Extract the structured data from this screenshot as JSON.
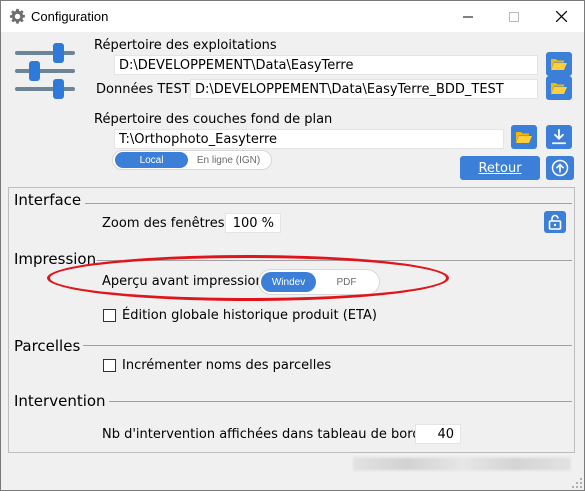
{
  "window": {
    "title": "Configuration",
    "icon": "gear-icon",
    "controls": {
      "minimize": "—",
      "maximize": "☐",
      "close": "✕"
    }
  },
  "top": {
    "exploitations_label": "Répertoire des exploitations",
    "exploitations_path": "D:\\DEVELOPPEMENT\\Data\\EasyTerre",
    "test_label": "Données TEST",
    "test_path": "D:\\DEVELOPPEMENT\\Data\\EasyTerre_BDD_TEST",
    "fond_label": "Répertoire des couches fond de plan",
    "fond_path": "T:\\Orthophoto_Easyterre",
    "source_toggle": {
      "options": [
        "Local",
        "En ligne (IGN)"
      ],
      "selected": "Local"
    },
    "retour_label": "Retour"
  },
  "interface": {
    "title": "Interface",
    "zoom_label": "Zoom des fenêtres",
    "zoom_value": "100 %"
  },
  "impression": {
    "title": "Impression",
    "apercu_label": "Aperçu avant impression",
    "apercu_toggle": {
      "options": [
        "Windev",
        "PDF"
      ],
      "selected": "Windev"
    },
    "edition_label": "Édition globale historique produit (ETA)",
    "edition_checked": false
  },
  "parcelles": {
    "title": "Parcelles",
    "incrementer_label": "Incrémenter noms des parcelles",
    "incrementer_checked": false
  },
  "intervention": {
    "title": "Intervention",
    "nb_label": "Nb d'intervention affichées dans tableau de bord",
    "nb_value": "40"
  },
  "colors": {
    "accent": "#3b7fd8",
    "highlight_ellipse": "#e0151b",
    "background": "#f0f0f0"
  }
}
